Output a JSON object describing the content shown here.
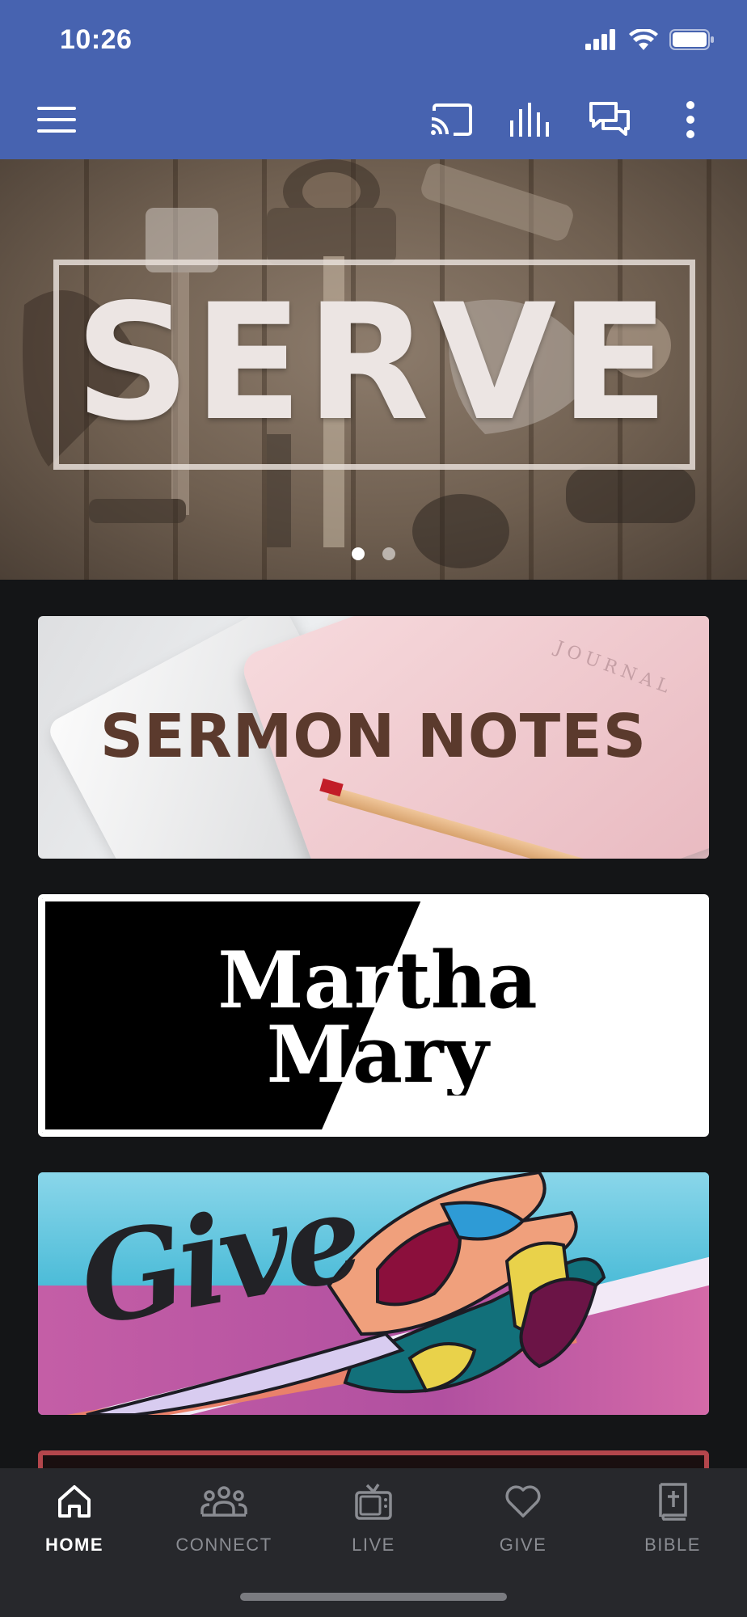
{
  "status_bar": {
    "time": "10:26"
  },
  "toolbar": {
    "menu_icon": "hamburger-menu-icon",
    "cast_icon": "cast-icon",
    "audio_icon": "audio-bars-icon",
    "chat_icon": "chat-icon",
    "more_icon": "more-vertical-icon",
    "background_color": "#4763b0"
  },
  "hero": {
    "title": "SERVE",
    "slides_total": 2,
    "active_slide": 1
  },
  "tiles": [
    {
      "title": "SERMON NOTES",
      "decor_text": "JOURNAL"
    },
    {
      "title_line1": "Martha",
      "title_line2": "Mary"
    },
    {
      "title": "Give"
    }
  ],
  "tab_bar": {
    "tabs": [
      {
        "label": "HOME",
        "icon": "home-icon",
        "active": true
      },
      {
        "label": "CONNECT",
        "icon": "people-icon",
        "active": false
      },
      {
        "label": "LIVE",
        "icon": "tv-icon",
        "active": false
      },
      {
        "label": "GIVE",
        "icon": "heart-icon",
        "active": false
      },
      {
        "label": "BIBLE",
        "icon": "bible-icon",
        "active": false
      }
    ]
  },
  "colors": {
    "app_bar": "#4763b0",
    "background": "#141517",
    "tab_bar": "#27282c",
    "tab_active": "#ffffff",
    "tab_inactive": "#8a8c92"
  }
}
